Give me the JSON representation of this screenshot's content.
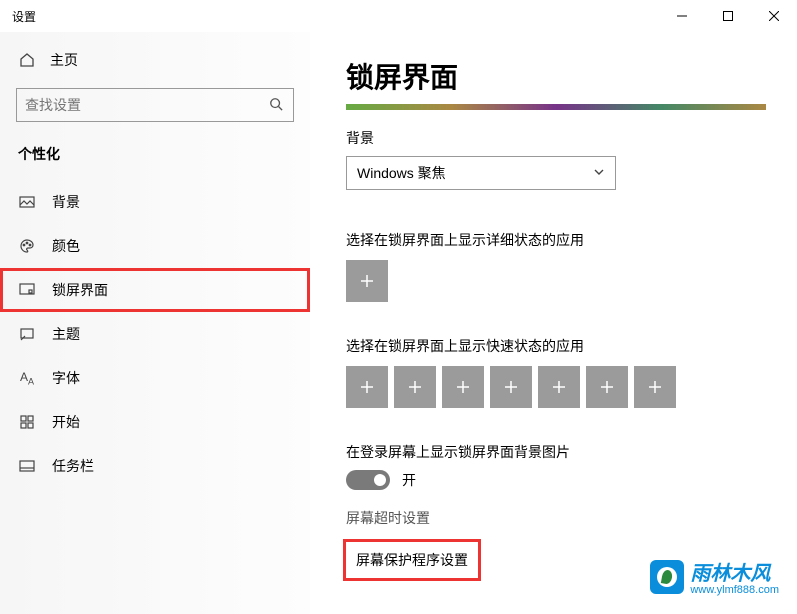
{
  "window": {
    "title": "设置"
  },
  "sidebar": {
    "home": "主页",
    "search_placeholder": "查找设置",
    "section": "个性化",
    "items": [
      {
        "label": "背景"
      },
      {
        "label": "颜色"
      },
      {
        "label": "锁屏界面"
      },
      {
        "label": "主题"
      },
      {
        "label": "字体"
      },
      {
        "label": "开始"
      },
      {
        "label": "任务栏"
      }
    ]
  },
  "main": {
    "title": "锁屏界面",
    "bg_label": "背景",
    "bg_value": "Windows 聚焦",
    "detailed_label": "选择在锁屏界面上显示详细状态的应用",
    "quick_label": "选择在锁屏界面上显示快速状态的应用",
    "login_pic_label": "在登录屏幕上显示锁屏界面背景图片",
    "toggle_state": "开",
    "timeout_link": "屏幕超时设置",
    "screensaver_link": "屏幕保护程序设置"
  },
  "watermark": {
    "text": "雨林木风",
    "url": "www.ylmf888.com"
  }
}
